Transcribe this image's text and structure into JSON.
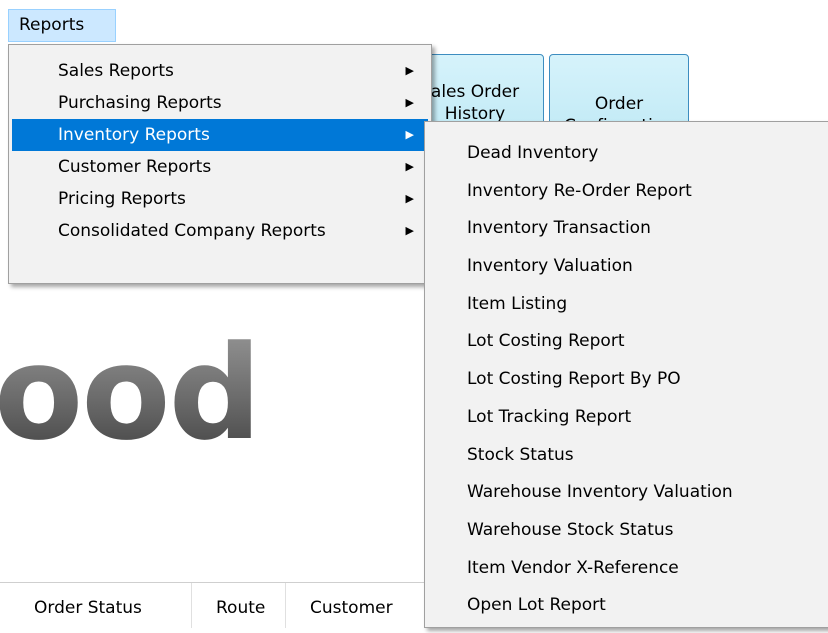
{
  "menubar": {
    "reports_label": "Reports"
  },
  "toolbar": {
    "sales_order_history": "ales Order\nHistory",
    "order_confirmation": "Order\nConfirmation"
  },
  "brand": {
    "text": "ood"
  },
  "grid": {
    "columns": [
      "Order Status",
      "Route",
      "Customer"
    ]
  },
  "reports_menu": {
    "items": [
      {
        "label": "Sales Reports",
        "has_submenu": true
      },
      {
        "label": "Purchasing Reports",
        "has_submenu": true
      },
      {
        "label": "Inventory Reports",
        "has_submenu": true,
        "active": true
      },
      {
        "label": "Customer Reports",
        "has_submenu": true
      },
      {
        "label": "Pricing Reports",
        "has_submenu": true
      },
      {
        "label": "Consolidated Company Reports",
        "has_submenu": true
      }
    ]
  },
  "inventory_menu": {
    "items": [
      {
        "label": "Dead Inventory"
      },
      {
        "label": "Inventory Re-Order Report"
      },
      {
        "label": "Inventory Transaction"
      },
      {
        "label": "Inventory Valuation"
      },
      {
        "label": "Item Listing"
      },
      {
        "label": "Lot Costing Report"
      },
      {
        "label": "Lot Costing Report By PO"
      },
      {
        "label": "Lot Tracking Report"
      },
      {
        "label": "Stock Status"
      },
      {
        "label": "Warehouse Inventory Valuation"
      },
      {
        "label": "Warehouse Stock Status"
      },
      {
        "label": "Item Vendor X-Reference"
      },
      {
        "label": "Open Lot Report"
      }
    ]
  },
  "colors": {
    "highlight": "#0078d7",
    "menubar_active": "#cce8ff",
    "button_fill": "#bfe9f5"
  }
}
